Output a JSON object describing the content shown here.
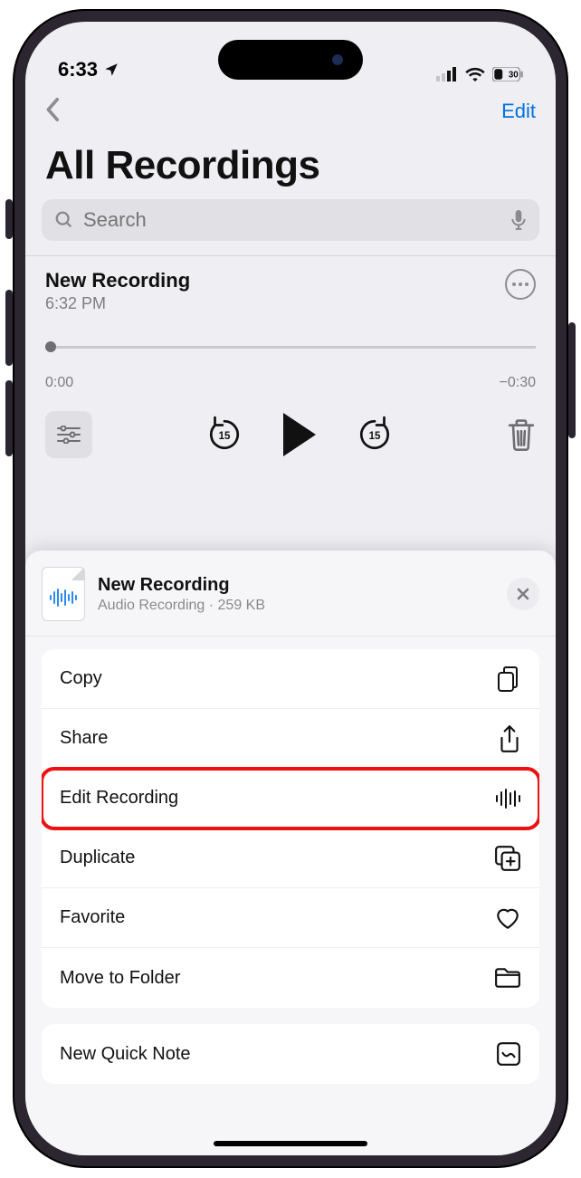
{
  "status": {
    "time": "6:33",
    "battery_label": "30"
  },
  "nav": {
    "edit": "Edit"
  },
  "page_title": "All Recordings",
  "search": {
    "placeholder": "Search"
  },
  "recording": {
    "title": "New Recording",
    "timestamp": "6:32 PM",
    "elapsed": "0:00",
    "remaining": "−0:30"
  },
  "sheet": {
    "title": "New Recording",
    "subtitle": "Audio Recording · 259 KB",
    "actions": [
      {
        "label": "Copy"
      },
      {
        "label": "Share"
      },
      {
        "label": "Edit Recording"
      },
      {
        "label": "Duplicate"
      },
      {
        "label": "Favorite"
      },
      {
        "label": "Move to Folder"
      }
    ],
    "quick_note": {
      "label": "New Quick Note"
    }
  }
}
